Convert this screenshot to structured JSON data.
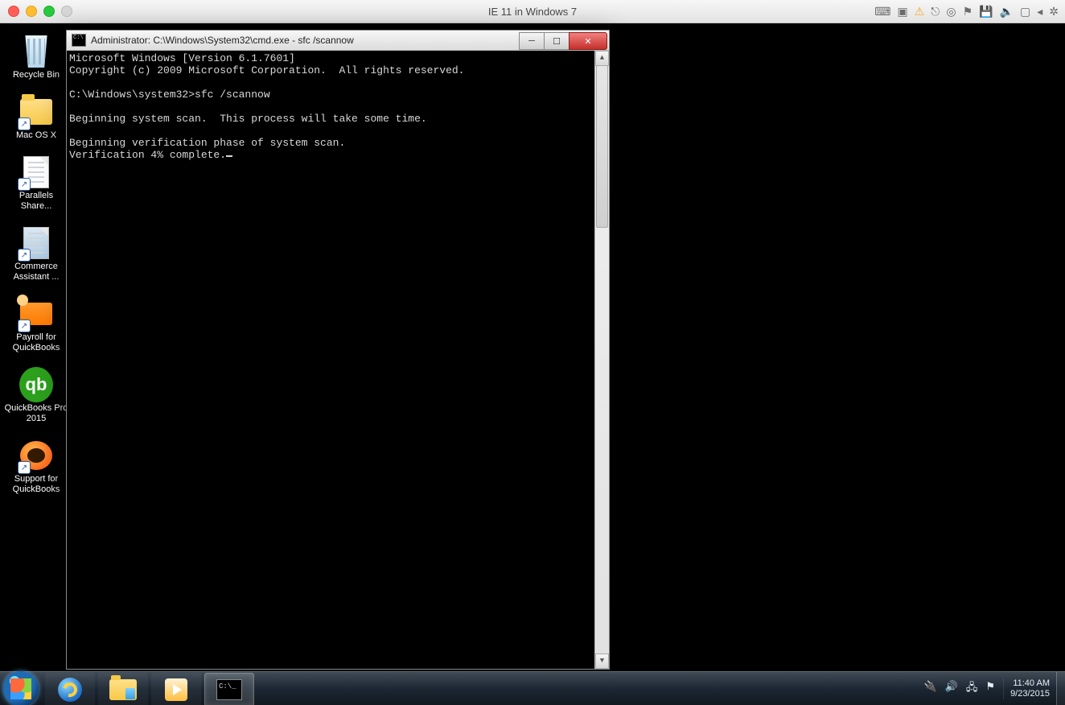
{
  "mac": {
    "vm_title": "IE 11 in Windows 7",
    "menu_icons": [
      "keyboard",
      "picture-in-picture",
      "warning",
      "usb",
      "cd",
      "clipboard",
      "floppy",
      "sound",
      "display",
      "collapse",
      "gear"
    ]
  },
  "desktop_icons": [
    {
      "id": "recycle-bin",
      "label": "Recycle Bin"
    },
    {
      "id": "mac-os-x",
      "label": "Mac OS X"
    },
    {
      "id": "parallels-share",
      "label": "Parallels Share..."
    },
    {
      "id": "commerce-assistant",
      "label": "Commerce Assistant ..."
    },
    {
      "id": "payroll-quickbooks",
      "label": "Payroll for QuickBooks"
    },
    {
      "id": "quickbooks-pro",
      "label": "QuickBooks Pro 2015"
    },
    {
      "id": "support-quickbooks",
      "label": "Support for QuickBooks"
    }
  ],
  "cmd": {
    "title": "Administrator: C:\\Windows\\System32\\cmd.exe - sfc  /scannow",
    "lines": [
      "Microsoft Windows [Version 6.1.7601]",
      "Copyright (c) 2009 Microsoft Corporation.  All rights reserved.",
      "",
      "C:\\Windows\\system32>sfc /scannow",
      "",
      "Beginning system scan.  This process will take some time.",
      "",
      "Beginning verification phase of system scan.",
      "Verification 4% complete."
    ]
  },
  "taskbar": {
    "pinned": [
      {
        "id": "start",
        "name": "start-button"
      },
      {
        "id": "ie",
        "name": "internet-explorer"
      },
      {
        "id": "explorer",
        "name": "file-explorer"
      },
      {
        "id": "wmp",
        "name": "windows-media-player"
      },
      {
        "id": "cmd",
        "name": "command-prompt",
        "active": true
      }
    ],
    "tray_icons": [
      "power",
      "sound",
      "network",
      "action-center"
    ],
    "time": "11:40 AM",
    "date": "9/23/2015"
  }
}
